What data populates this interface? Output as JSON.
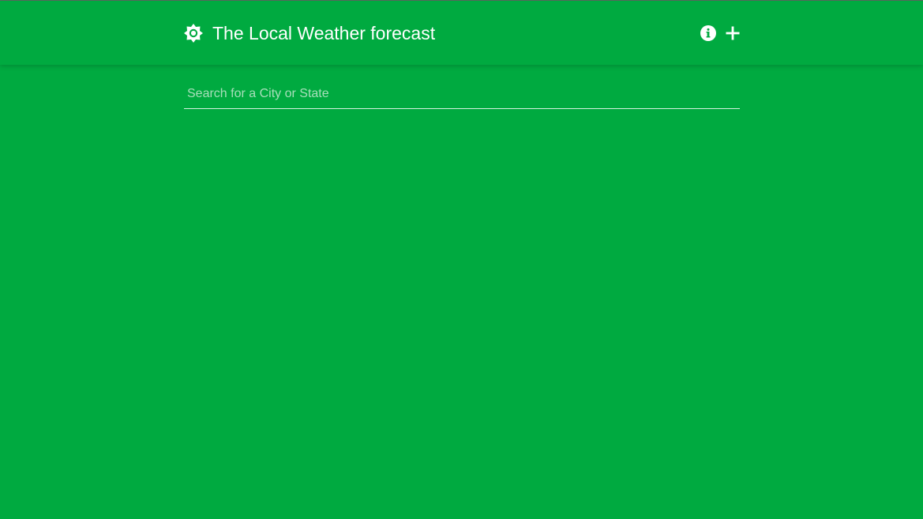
{
  "header": {
    "title": "The Local Weather forecast",
    "logo_icon": "sun-icon",
    "actions": [
      {
        "name": "info-button",
        "icon": "info-circle-icon"
      },
      {
        "name": "add-city-button",
        "icon": "plus-icon"
      }
    ]
  },
  "search": {
    "placeholder": "Search for a City or State",
    "value": ""
  },
  "theme": {
    "primary": "#00aa40",
    "text": "#ffffff",
    "input_underline": "#d8f3e1",
    "placeholder": "#a9dfbb"
  }
}
